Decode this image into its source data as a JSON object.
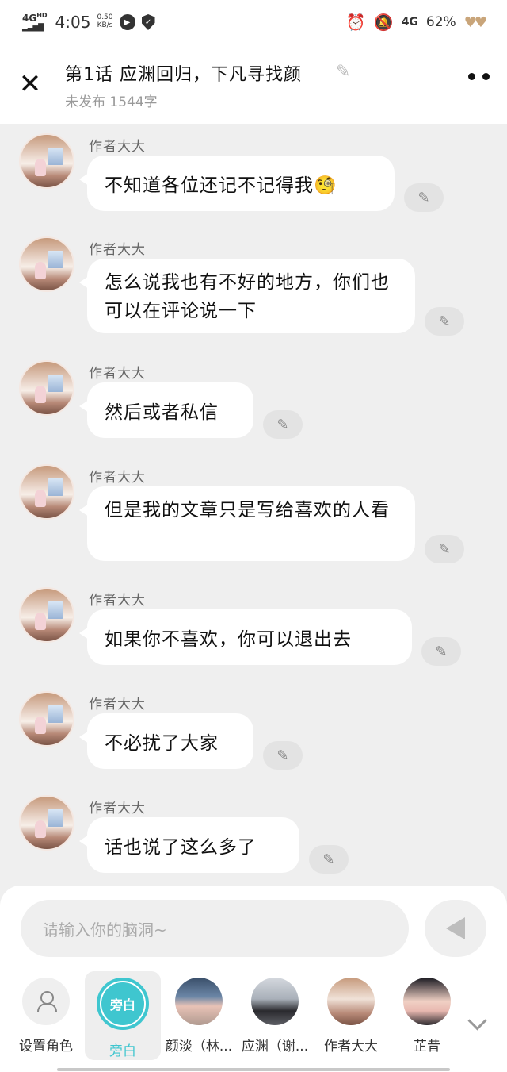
{
  "status_bar": {
    "network": "4G",
    "network_super": "HD",
    "time": "4:05",
    "speed_value": "0.50",
    "speed_unit": "KB/s",
    "network_right": "4G",
    "battery": "62%"
  },
  "header": {
    "title": "第1话  应渊回归，下凡寻找颜",
    "subtitle": "未发布 1544字"
  },
  "messages": [
    {
      "author": "作者大大",
      "text": "不知道各位还记不记得我🧐"
    },
    {
      "author": "作者大大",
      "text": "怎么说我也有不好的地方，你们也可以在评论说一下"
    },
    {
      "author": "作者大大",
      "text": "然后或者私信"
    },
    {
      "author": "作者大大",
      "text": "但是我的文章只是写给喜欢的人看"
    },
    {
      "author": "作者大大",
      "text": "如果你不喜欢，你可以退出去"
    },
    {
      "author": "作者大大",
      "text": "不必扰了大家"
    },
    {
      "author": "作者大大",
      "text": "话也说了这么多了"
    }
  ],
  "composer": {
    "placeholder": "请输入你的脑洞~"
  },
  "roles": [
    {
      "label": "设置角色",
      "icon": "person-settings-icon"
    },
    {
      "label": "旁白",
      "badge": "旁白",
      "selected": true
    },
    {
      "label": "颜淡（林..."
    },
    {
      "label": "应渊（谢..."
    },
    {
      "label": "作者大大"
    },
    {
      "label": "芷昔"
    }
  ],
  "colors": {
    "accent": "#3fc6cf",
    "background": "#efefef",
    "bubble": "#ffffff"
  }
}
